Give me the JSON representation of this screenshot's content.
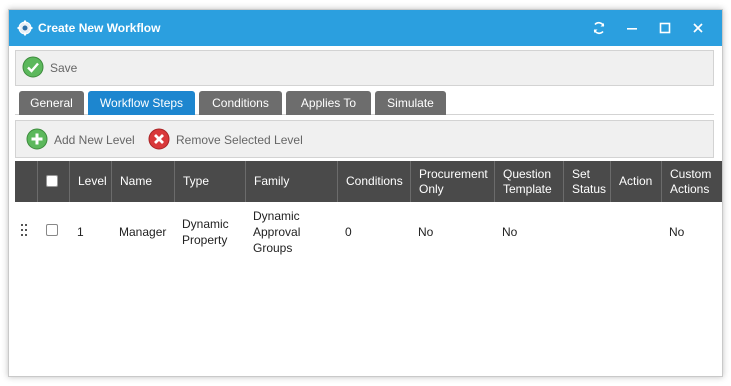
{
  "window": {
    "title": "Create New Workflow",
    "icons": [
      "gear-icon",
      "refresh-icon",
      "minimize-icon",
      "maximize-icon",
      "close-icon"
    ]
  },
  "toolbar": {
    "save_label": "Save"
  },
  "tabs": [
    {
      "label": "General",
      "active": false
    },
    {
      "label": "Workflow Steps",
      "active": true
    },
    {
      "label": "Conditions",
      "active": false
    },
    {
      "label": "Applies To",
      "active": false
    },
    {
      "label": "Simulate",
      "active": false
    }
  ],
  "level_toolbar": {
    "add_label": "Add New Level",
    "remove_label": "Remove Selected Level"
  },
  "grid": {
    "columns": [
      "Level",
      "Name",
      "Type",
      "Family",
      "Conditions",
      "Procurement Only",
      "Question Template",
      "Set Status",
      "Action",
      "Custom Actions"
    ],
    "rows": [
      {
        "level": "1",
        "name": "Manager",
        "type": "Dynamic Property",
        "family": "Dynamic Approval Groups",
        "conditions": "0",
        "procurement_only": "No",
        "question_template": "No",
        "set_status": "",
        "action": "",
        "custom_actions": "No"
      }
    ]
  },
  "colors": {
    "titlebar": "#2b9fdf",
    "active_tab": "#1d86cf",
    "inactive_tab": "#6d6d6d",
    "grid_header": "#4a4a4a",
    "save_icon": "#4caf50",
    "add_icon": "#4caf50",
    "remove_icon": "#d32f2f"
  }
}
